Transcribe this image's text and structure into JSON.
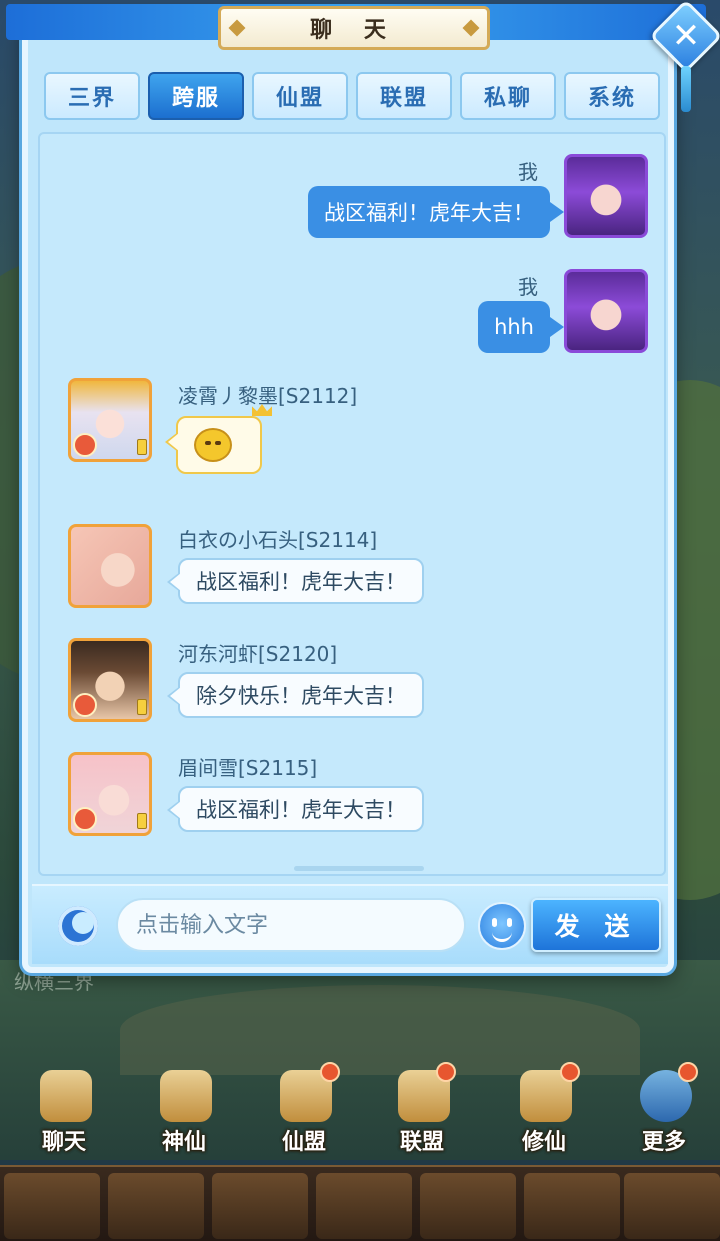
{
  "window": {
    "title": "聊 天",
    "close_label": "✕"
  },
  "tabs": [
    {
      "label": "三界",
      "active": false
    },
    {
      "label": "跨服",
      "active": true
    },
    {
      "label": "仙盟",
      "active": false
    },
    {
      "label": "联盟",
      "active": false
    },
    {
      "label": "私聊",
      "active": false
    },
    {
      "label": "系统",
      "active": false
    }
  ],
  "messages": [
    {
      "sender": "我",
      "text": "战区福利！虎年大吉！",
      "mine": true
    },
    {
      "sender": "我",
      "text": "hhh",
      "mine": true
    },
    {
      "sender": "凌霄丿黎墨[S2112]",
      "text": "",
      "mine": false,
      "emoji": "smile-sticker"
    },
    {
      "sender": "白衣の小石头[S2114]",
      "text": "战区福利！虎年大吉！",
      "mine": false
    },
    {
      "sender": "河东河虾[S2120]",
      "text": "除夕快乐！虎年大吉！",
      "mine": false
    },
    {
      "sender": "眉间雪[S2115]",
      "text": "战区福利！虎年大吉！",
      "mine": false
    }
  ],
  "input": {
    "placeholder": "点击输入文字",
    "value": ""
  },
  "send_label": "发 送",
  "background_text": "纵横三界",
  "bottom_menu": [
    {
      "label": "聊天",
      "badge": false
    },
    {
      "label": "神仙",
      "badge": false
    },
    {
      "label": "仙盟",
      "badge": true
    },
    {
      "label": "联盟",
      "badge": true
    },
    {
      "label": "修仙",
      "badge": true
    },
    {
      "label": "更多",
      "badge": true
    }
  ],
  "colors": {
    "accent": "#1c6fcf",
    "panel_bg": "#bfe6fb",
    "my_bubble": "#3a8fe4",
    "other_bubble": "#f8fcff"
  },
  "icons": [
    "close-icon",
    "moon-icon",
    "smile-icon",
    "emoji-sticker-icon",
    "crown-icon"
  ]
}
